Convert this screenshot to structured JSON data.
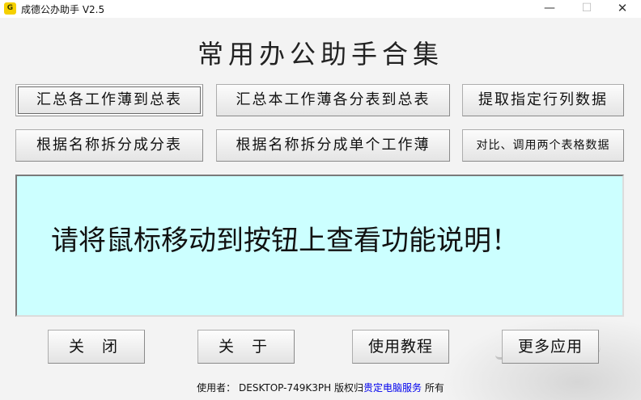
{
  "window": {
    "title": "成德公办助手 V2.5",
    "icon_text": "G",
    "controls": {
      "minimize": "—",
      "maximize": "☐",
      "close": "✕"
    }
  },
  "main_title": "常用办公助手合集",
  "function_buttons": {
    "row1": [
      "汇总各工作薄到总表",
      "汇总本工作薄各分表到总表",
      "提取指定行列数据"
    ],
    "row2": [
      "根据名称拆分成分表",
      "根据名称拆分成单个工作薄",
      "对比、调用两个表格数据"
    ]
  },
  "info_panel": {
    "text": "请将鼠标移动到按钮上查看功能说明！"
  },
  "bottom_buttons": {
    "close": "关 闭",
    "about": "关 于",
    "tutorial": "使用教程",
    "more_apps": "更多应用"
  },
  "footer": {
    "user_label": "使用者：",
    "user_value": "DESKTOP-749K3PH",
    "rights_label": "版权归",
    "owner": "贵定电脑服务",
    "rights_suffix": "所有"
  },
  "colors": {
    "panel_bg": "#ccffff",
    "window_bg": "#f3f3f3",
    "link": "#0000ee"
  }
}
